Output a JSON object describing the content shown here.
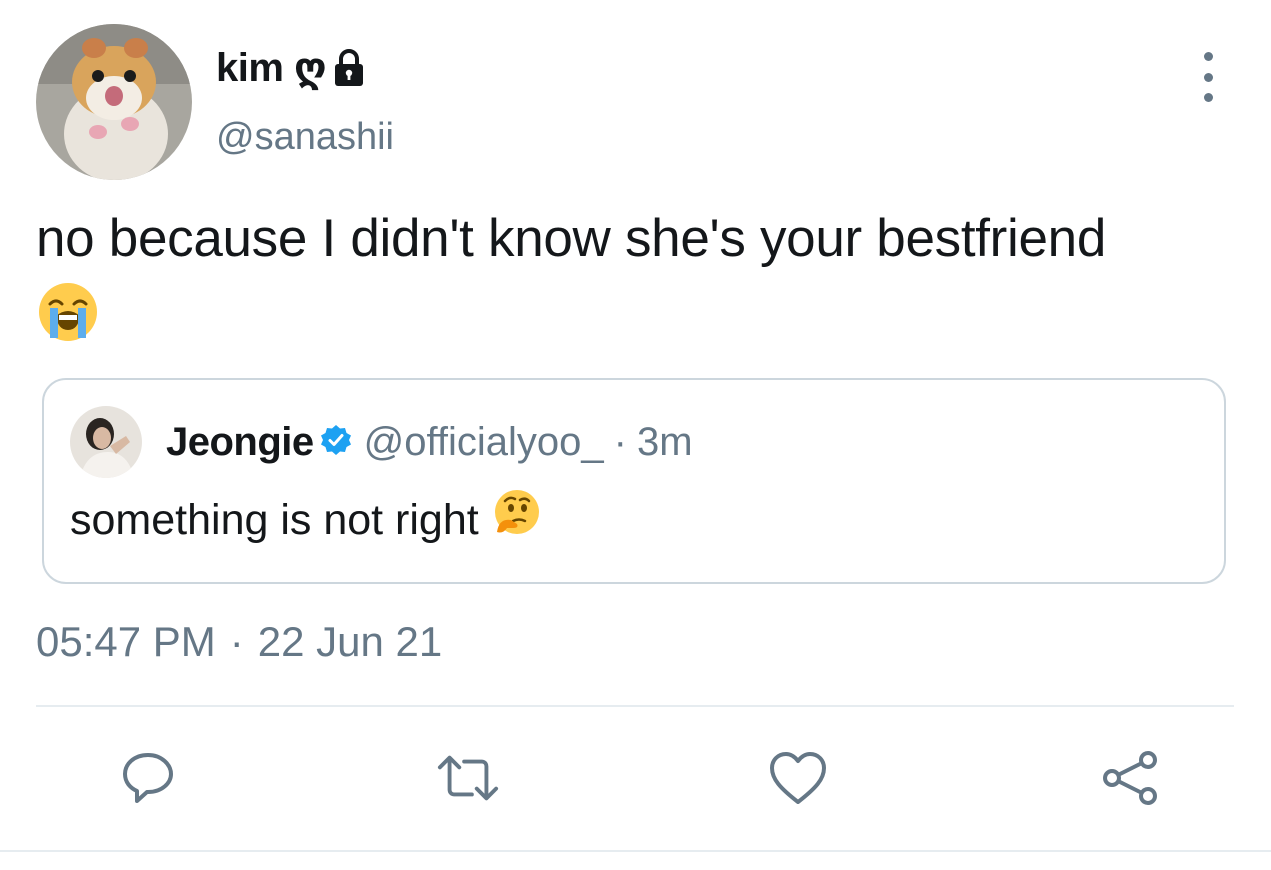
{
  "author": {
    "display_name": "kim ღ",
    "handle": "@sanashii",
    "avatar_icon": "hamster-avatar",
    "lock_icon": "lock-icon"
  },
  "tweet": {
    "text": "no because I didn't know she's your bestfriend",
    "emoji": "loudly-crying-face-emoji",
    "timestamp_time": "05:47 PM",
    "timestamp_sep": "·",
    "timestamp_date": "22 Jun 21"
  },
  "quoted_tweet": {
    "display_name": "Jeongie",
    "verified": true,
    "handle": "@officialyoo_",
    "separator": "·",
    "time": "3m",
    "text": "something is not right",
    "emoji": "thinking-face-emoji"
  },
  "actions": [
    "reply-icon",
    "retweet-icon",
    "like-icon",
    "share-icon"
  ],
  "colors": {
    "text": "#14171a",
    "secondary": "#657786",
    "border": "#ccd6dd",
    "verified": "#1da1f2"
  }
}
